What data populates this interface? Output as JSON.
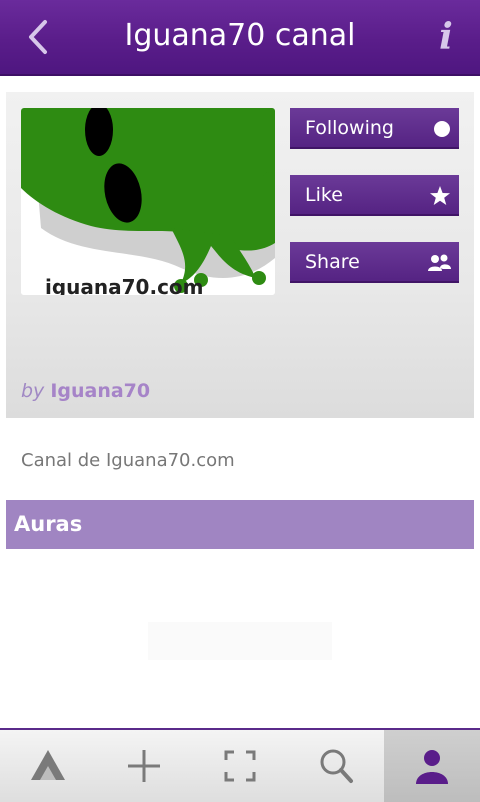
{
  "header": {
    "title": "Iguana70 canal",
    "back_icon": "chevron-left-icon",
    "info_icon": "info-icon",
    "info_glyph": "i"
  },
  "channel": {
    "thumbnail_text": "iguana70.com",
    "by_label": "by",
    "author": "Iguana70",
    "description": "Canal de Iguana70.com"
  },
  "actions": [
    {
      "label": "Following",
      "icon": "toggle-dot-icon"
    },
    {
      "label": "Like",
      "icon": "star-icon"
    },
    {
      "label": "Share",
      "icon": "people-icon"
    }
  ],
  "section": {
    "title": "Auras"
  },
  "bottom_nav": [
    {
      "icon": "aura-logo-icon",
      "active": false
    },
    {
      "icon": "plus-icon",
      "active": false
    },
    {
      "icon": "scan-frame-icon",
      "active": false
    },
    {
      "icon": "search-icon",
      "active": false
    },
    {
      "icon": "profile-icon",
      "active": true
    }
  ],
  "colors": {
    "header": "#5a1d8a",
    "button": "#5b2788",
    "section_bar": "#a085c2",
    "author": "#a684c8"
  }
}
